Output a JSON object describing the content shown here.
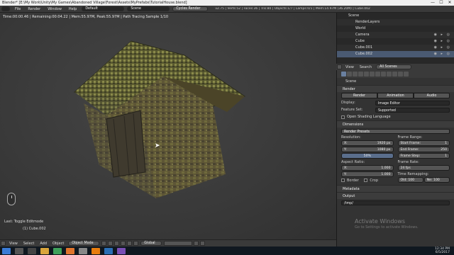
{
  "window": {
    "title": "Blender* [E:\\My Work\\Unity\\My Games\\Abandoned Village\\Forest\\Assets\\MyPrefabs\\TutorialHouse.blend]",
    "minimize": "—",
    "maximize": "☐",
    "close": "✕"
  },
  "menu": {
    "items": [
      "File",
      "Render",
      "Window",
      "Help"
    ],
    "layout": "Default",
    "scene": "Scene",
    "engine": "Cycles Render",
    "stats": "v2.75 | Verts:52 | Faces:36 | Tris:80 | Objects:1/7 | Lamps:0/1 | Mem:14.97M (36.20M) | Cube.002"
  },
  "viewport": {
    "info": "Time:00:00.46 | Remaining:00:04.22 | Mem:55.97M, Peak:55.97M | Path Tracing Sample 1/10",
    "last_op": "Last: Toggle Editmode",
    "object_label": "(1) Cube.002",
    "header": [
      "View",
      "Select",
      "Add",
      "Object"
    ],
    "mode": "Object Mode",
    "pivot": "Global"
  },
  "outliner": {
    "rows": [
      {
        "label": "Scene"
      },
      {
        "label": "RenderLayers"
      },
      {
        "label": "World"
      },
      {
        "label": "Camera"
      },
      {
        "label": "Cube"
      },
      {
        "label": "Cube.001"
      },
      {
        "label": "Cube.002"
      }
    ],
    "footer": [
      "View",
      "Search",
      "All Scenes"
    ]
  },
  "properties": {
    "context": "Scene",
    "render_header": "Render",
    "render_buttons": [
      "Render",
      "Animation",
      "Audio"
    ],
    "display_label": "Display:",
    "display_value": "Image Editor",
    "feature_label": "Feature Set:",
    "feature_value": "Supported",
    "osl": "Open Shading Language",
    "dimensions_header": "Dimensions",
    "presets": "Render Presets",
    "resolution_h": "Resolution:",
    "frame_range_h": "Frame Range:",
    "res_x": {
      "k": "X:",
      "v": "1920 px"
    },
    "res_y": {
      "k": "Y:",
      "v": "1080 px"
    },
    "res_pct": "50%",
    "start": {
      "k": "Start Frame:",
      "v": "1"
    },
    "end": {
      "k": "End Frame:",
      "v": "250"
    },
    "step": {
      "k": "Frame Step:",
      "v": "1"
    },
    "aspect_h": "Aspect Ratio:",
    "frame_rate_h": "Frame Rate:",
    "asp_x": {
      "k": "X:",
      "v": "1.000"
    },
    "asp_y": {
      "k": "Y:",
      "v": "1.000"
    },
    "fps": "24 fps",
    "remap_h": "Time Remapping:",
    "border": "Border",
    "crop": "Crop",
    "old": "Old: 100",
    "new": "Ne: 100",
    "metadata_header": "Metadata",
    "output_header": "Output",
    "output_path": "/tmp/"
  },
  "watermark": {
    "line1": "Activate Windows",
    "line2": "Go to Settings to activate Windows."
  },
  "taskbar": {
    "time": "12:34 PM",
    "date": "6/5/2017"
  }
}
